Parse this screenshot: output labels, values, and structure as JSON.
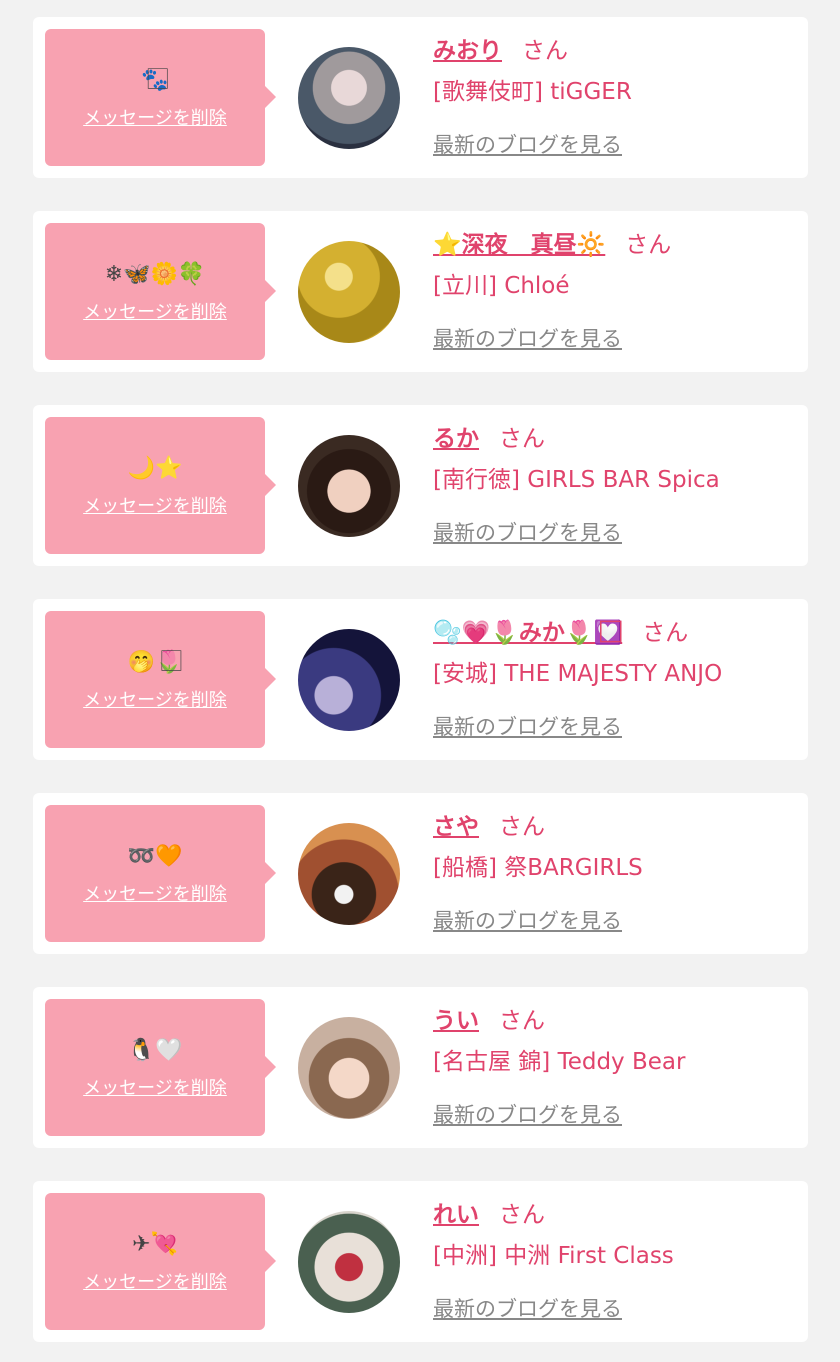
{
  "delete_label": "メッセージを削除",
  "blog_label": "最新のブログを見る",
  "accent_color": "#e0436c",
  "bubble_color": "#f8a2b1",
  "cards": [
    {
      "emoji": "🐾⃞",
      "name": "みおり",
      "honorific": "さん",
      "shop": "[歌舞伎町] tiGGER"
    },
    {
      "emoji": "❄🦋🌼🍀",
      "name": "⭐深夜　真昼🔆",
      "honorific": "さん",
      "shop": "[立川] Chloé"
    },
    {
      "emoji": "🌙⭐",
      "name": "るか",
      "honorific": "さん",
      "shop": "[南行徳] GIRLS BAR Spica"
    },
    {
      "emoji": "🤭🌷⃞",
      "name": "🫧💗🌷みか🌷💟⃞",
      "honorific": "さん",
      "shop": "[安城] THE MAJESTY ANJO"
    },
    {
      "emoji": "➿🧡",
      "name": "さや",
      "honorific": "さん",
      "shop": "[船橋] 祭BARGIRLS"
    },
    {
      "emoji": "🐧🤍",
      "name": "うい",
      "honorific": "さん",
      "shop": "[名古屋 錦] Teddy Bear"
    },
    {
      "emoji": "✈💘",
      "name": "れい",
      "honorific": "さん",
      "shop": "[中洲] 中洲 First Class"
    }
  ]
}
